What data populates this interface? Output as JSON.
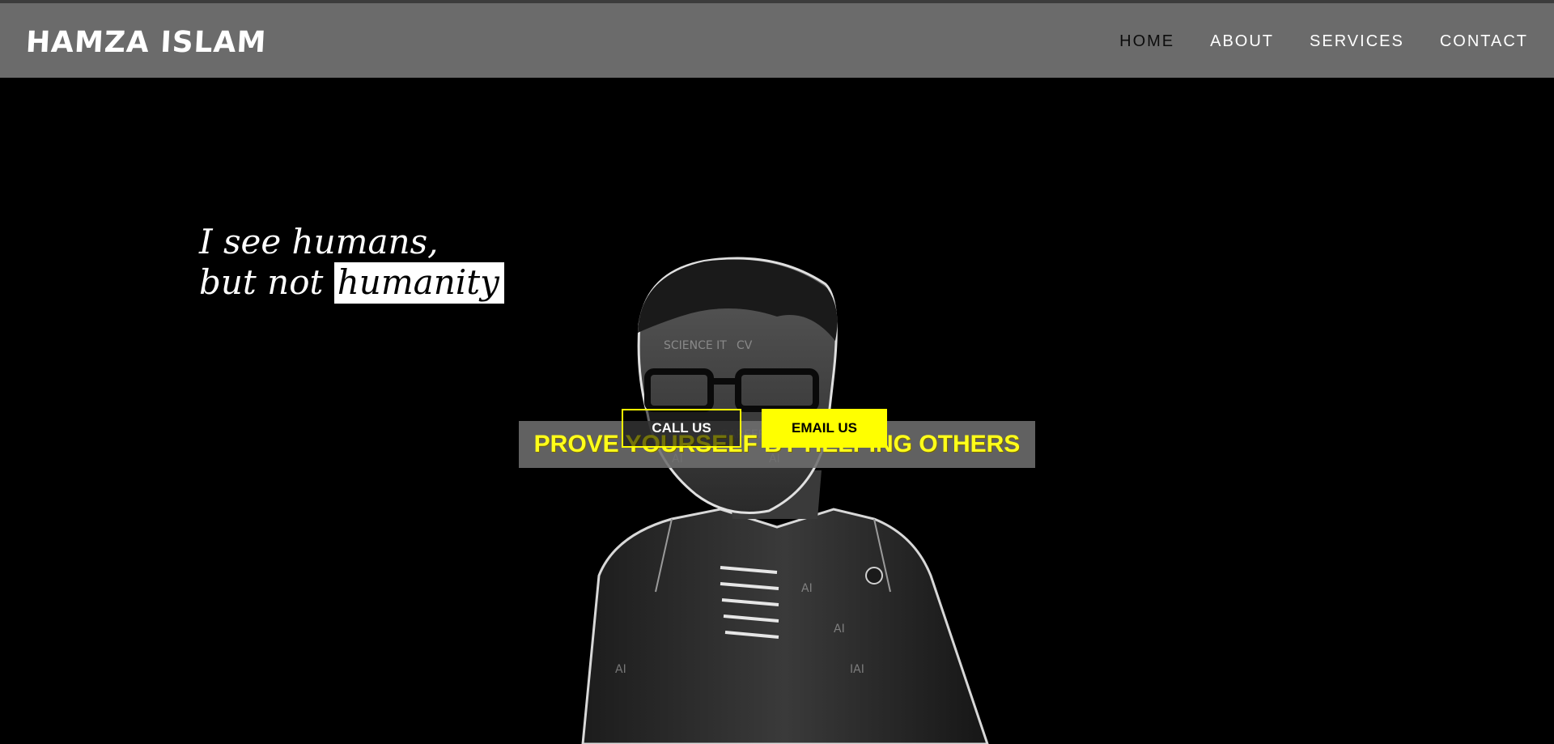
{
  "brand": {
    "name": "HAMZA ISLAM"
  },
  "nav": {
    "items": [
      {
        "label": "HOME",
        "active": true
      },
      {
        "label": "ABOUT",
        "active": false
      },
      {
        "label": "SERVICES",
        "active": false
      },
      {
        "label": "CONTACT",
        "active": false
      }
    ]
  },
  "hero": {
    "quote_line1": "I see humans,",
    "quote_line2_prefix": "but not",
    "quote_line2_highlight": "humanity",
    "tagline": "PROVE YOURSELF BY HELPING OTHERS",
    "call_button": "CALL US",
    "email_button": "EMAIL US"
  },
  "colors": {
    "navbar": "#6b6b6b",
    "background": "#000000",
    "accent": "#ffff00",
    "text": "#ffffff"
  }
}
